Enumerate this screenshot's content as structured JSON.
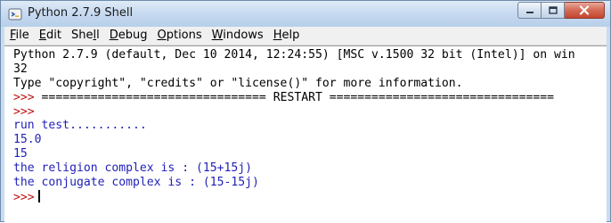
{
  "window": {
    "title": "Python 2.7.9 Shell",
    "icon": "python-idle-icon"
  },
  "menu": {
    "items": [
      {
        "first": "F",
        "rest": "ile"
      },
      {
        "first": "E",
        "rest": "dit"
      },
      {
        "first": "She",
        "ul": "l",
        "rest": "l"
      },
      {
        "first": "D",
        "rest": "ebug"
      },
      {
        "first": "O",
        "rest": "ptions"
      },
      {
        "first": "W",
        "rest": "indows"
      },
      {
        "first": "H",
        "rest": "elp"
      }
    ]
  },
  "shell": {
    "banner_1": "Python 2.7.9 (default, Dec 10 2014, 12:24:55) [MSC v.1500 32 bit (Intel)] on win",
    "banner_2": "32",
    "banner_3": "Type \"copyright\", \"credits\" or \"license()\" for more information.",
    "restart_prompt": ">>> ",
    "restart_line": "================================ RESTART ================================",
    "prompt_1": ">>>",
    "out_1": "run test...........",
    "out_2": "15.0",
    "out_3": "15",
    "out_4": "the religion complex is : (15+15j)",
    "out_5": "the conjugate complex is : (15-15j)",
    "prompt_final": ">>>"
  },
  "colors": {
    "output": "#1f1fb8",
    "prompt": "#c01010"
  }
}
